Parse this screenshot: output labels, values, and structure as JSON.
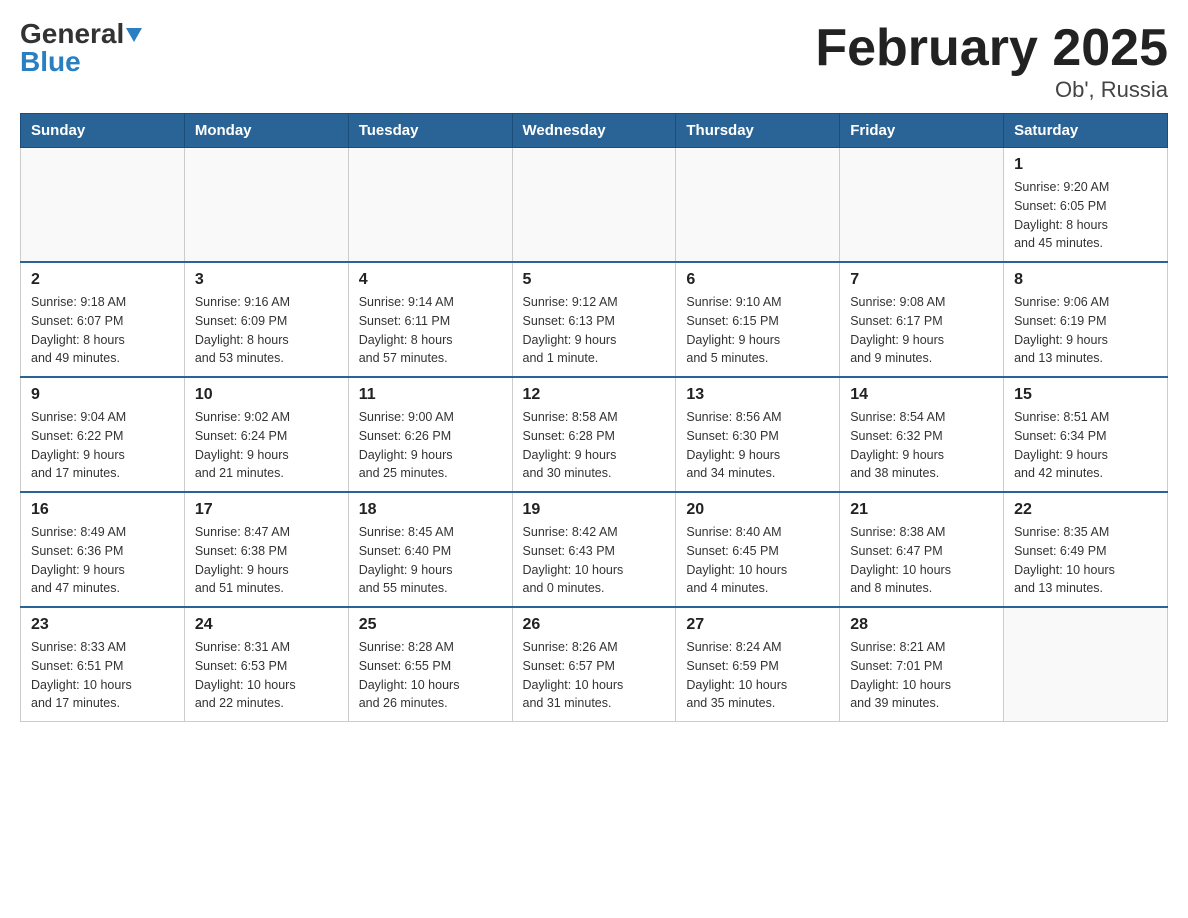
{
  "logo": {
    "general": "General",
    "blue": "Blue"
  },
  "title": "February 2025",
  "subtitle": "Ob', Russia",
  "days_of_week": [
    "Sunday",
    "Monday",
    "Tuesday",
    "Wednesday",
    "Thursday",
    "Friday",
    "Saturday"
  ],
  "weeks": [
    [
      {
        "day": "",
        "info": ""
      },
      {
        "day": "",
        "info": ""
      },
      {
        "day": "",
        "info": ""
      },
      {
        "day": "",
        "info": ""
      },
      {
        "day": "",
        "info": ""
      },
      {
        "day": "",
        "info": ""
      },
      {
        "day": "1",
        "info": "Sunrise: 9:20 AM\nSunset: 6:05 PM\nDaylight: 8 hours\nand 45 minutes."
      }
    ],
    [
      {
        "day": "2",
        "info": "Sunrise: 9:18 AM\nSunset: 6:07 PM\nDaylight: 8 hours\nand 49 minutes."
      },
      {
        "day": "3",
        "info": "Sunrise: 9:16 AM\nSunset: 6:09 PM\nDaylight: 8 hours\nand 53 minutes."
      },
      {
        "day": "4",
        "info": "Sunrise: 9:14 AM\nSunset: 6:11 PM\nDaylight: 8 hours\nand 57 minutes."
      },
      {
        "day": "5",
        "info": "Sunrise: 9:12 AM\nSunset: 6:13 PM\nDaylight: 9 hours\nand 1 minute."
      },
      {
        "day": "6",
        "info": "Sunrise: 9:10 AM\nSunset: 6:15 PM\nDaylight: 9 hours\nand 5 minutes."
      },
      {
        "day": "7",
        "info": "Sunrise: 9:08 AM\nSunset: 6:17 PM\nDaylight: 9 hours\nand 9 minutes."
      },
      {
        "day": "8",
        "info": "Sunrise: 9:06 AM\nSunset: 6:19 PM\nDaylight: 9 hours\nand 13 minutes."
      }
    ],
    [
      {
        "day": "9",
        "info": "Sunrise: 9:04 AM\nSunset: 6:22 PM\nDaylight: 9 hours\nand 17 minutes."
      },
      {
        "day": "10",
        "info": "Sunrise: 9:02 AM\nSunset: 6:24 PM\nDaylight: 9 hours\nand 21 minutes."
      },
      {
        "day": "11",
        "info": "Sunrise: 9:00 AM\nSunset: 6:26 PM\nDaylight: 9 hours\nand 25 minutes."
      },
      {
        "day": "12",
        "info": "Sunrise: 8:58 AM\nSunset: 6:28 PM\nDaylight: 9 hours\nand 30 minutes."
      },
      {
        "day": "13",
        "info": "Sunrise: 8:56 AM\nSunset: 6:30 PM\nDaylight: 9 hours\nand 34 minutes."
      },
      {
        "day": "14",
        "info": "Sunrise: 8:54 AM\nSunset: 6:32 PM\nDaylight: 9 hours\nand 38 minutes."
      },
      {
        "day": "15",
        "info": "Sunrise: 8:51 AM\nSunset: 6:34 PM\nDaylight: 9 hours\nand 42 minutes."
      }
    ],
    [
      {
        "day": "16",
        "info": "Sunrise: 8:49 AM\nSunset: 6:36 PM\nDaylight: 9 hours\nand 47 minutes."
      },
      {
        "day": "17",
        "info": "Sunrise: 8:47 AM\nSunset: 6:38 PM\nDaylight: 9 hours\nand 51 minutes."
      },
      {
        "day": "18",
        "info": "Sunrise: 8:45 AM\nSunset: 6:40 PM\nDaylight: 9 hours\nand 55 minutes."
      },
      {
        "day": "19",
        "info": "Sunrise: 8:42 AM\nSunset: 6:43 PM\nDaylight: 10 hours\nand 0 minutes."
      },
      {
        "day": "20",
        "info": "Sunrise: 8:40 AM\nSunset: 6:45 PM\nDaylight: 10 hours\nand 4 minutes."
      },
      {
        "day": "21",
        "info": "Sunrise: 8:38 AM\nSunset: 6:47 PM\nDaylight: 10 hours\nand 8 minutes."
      },
      {
        "day": "22",
        "info": "Sunrise: 8:35 AM\nSunset: 6:49 PM\nDaylight: 10 hours\nand 13 minutes."
      }
    ],
    [
      {
        "day": "23",
        "info": "Sunrise: 8:33 AM\nSunset: 6:51 PM\nDaylight: 10 hours\nand 17 minutes."
      },
      {
        "day": "24",
        "info": "Sunrise: 8:31 AM\nSunset: 6:53 PM\nDaylight: 10 hours\nand 22 minutes."
      },
      {
        "day": "25",
        "info": "Sunrise: 8:28 AM\nSunset: 6:55 PM\nDaylight: 10 hours\nand 26 minutes."
      },
      {
        "day": "26",
        "info": "Sunrise: 8:26 AM\nSunset: 6:57 PM\nDaylight: 10 hours\nand 31 minutes."
      },
      {
        "day": "27",
        "info": "Sunrise: 8:24 AM\nSunset: 6:59 PM\nDaylight: 10 hours\nand 35 minutes."
      },
      {
        "day": "28",
        "info": "Sunrise: 8:21 AM\nSunset: 7:01 PM\nDaylight: 10 hours\nand 39 minutes."
      },
      {
        "day": "",
        "info": ""
      }
    ]
  ]
}
